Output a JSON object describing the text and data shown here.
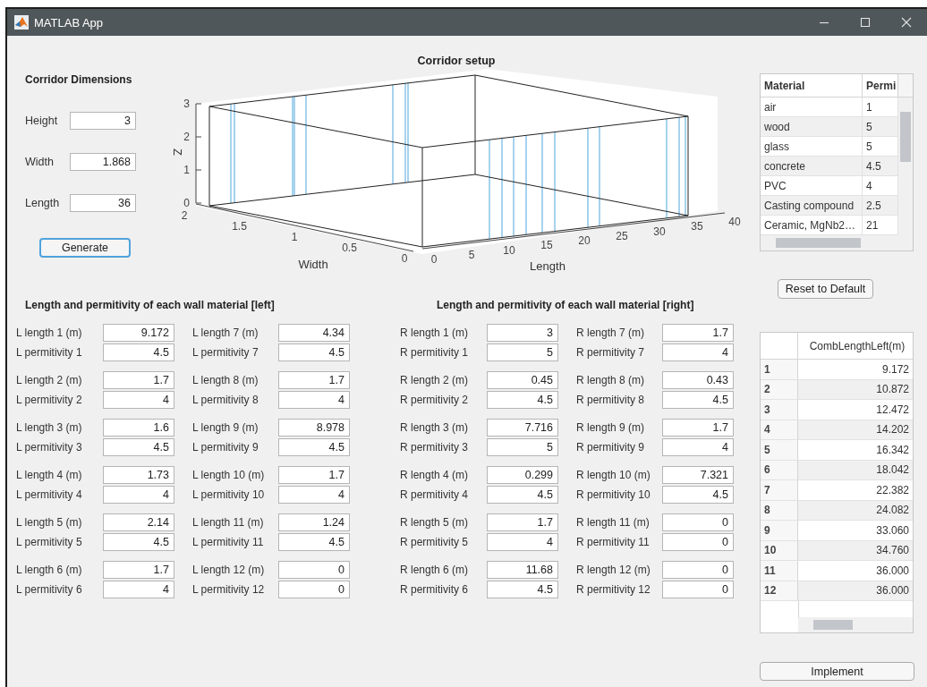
{
  "window": {
    "title": "MATLAB App"
  },
  "corridor_dimensions": {
    "title": "Corridor Dimensions",
    "fields": [
      {
        "label": "Height",
        "value": "3"
      },
      {
        "label": "Width",
        "value": "1.868"
      },
      {
        "label": "Length",
        "value": "36"
      }
    ],
    "generate_button": {
      "label": "Generate",
      "focused": true
    }
  },
  "plot": {
    "title": "Corridor setup",
    "z_label": "Z",
    "z_ticks": [
      "3",
      "2",
      "1",
      "0"
    ],
    "width_label": "Width",
    "width_ticks": [
      "2",
      "1.5",
      "1",
      "0.5",
      "0"
    ],
    "length_label": "Length",
    "length_ticks": [
      "0",
      "5",
      "10",
      "15",
      "20",
      "25",
      "30",
      "35",
      "40"
    ]
  },
  "walls": [
    {
      "title": "Length and permitivity of each wall material [left]",
      "entries": [
        {
          "length_label": "L length 1 (m)",
          "length": "9.172",
          "permittivity_label": "L permitivity 1",
          "permittivity": "4.5"
        },
        {
          "length_label": "L length 2 (m)",
          "length": "1.7",
          "permittivity_label": "L permitivity 2",
          "permittivity": "4"
        },
        {
          "length_label": "L length 3 (m)",
          "length": "1.6",
          "permittivity_label": "L permitivity 3",
          "permittivity": "4.5"
        },
        {
          "length_label": "L length 4 (m)",
          "length": "1.73",
          "permittivity_label": "L permitivity 4",
          "permittivity": "4"
        },
        {
          "length_label": "L length 5 (m)",
          "length": "2.14",
          "permittivity_label": "L permitivity 5",
          "permittivity": "4.5"
        },
        {
          "length_label": "L length 6 (m)",
          "length": "1.7",
          "permittivity_label": "L permitivity 6",
          "permittivity": "4"
        },
        {
          "length_label": "L length 7 (m)",
          "length": "4.34",
          "permittivity_label": "L permitivity 7",
          "permittivity": "4.5"
        },
        {
          "length_label": "L length 8 (m)",
          "length": "1.7",
          "permittivity_label": "L permitivity 8",
          "permittivity": "4"
        },
        {
          "length_label": "L length 9 (m)",
          "length": "8.978",
          "permittivity_label": "L permitivity 9",
          "permittivity": "4.5"
        },
        {
          "length_label": "L length 10 (m)",
          "length": "1.7",
          "permittivity_label": "L permitivity 10",
          "permittivity": "4"
        },
        {
          "length_label": "L length 11 (m)",
          "length": "1.24",
          "permittivity_label": "L permitivity 11",
          "permittivity": "4.5"
        },
        {
          "length_label": "L length 12 (m)",
          "length": "0",
          "permittivity_label": "L permitivity 12",
          "permittivity": "0"
        }
      ]
    },
    {
      "title": "Length and permitivity of each wall material [right]",
      "entries": [
        {
          "length_label": "R length 1 (m)",
          "length": "3",
          "permittivity_label": "R permitivity 1",
          "permittivity": "5"
        },
        {
          "length_label": "R length 2 (m)",
          "length": "0.45",
          "permittivity_label": "R permitivity 2",
          "permittivity": "4.5"
        },
        {
          "length_label": "R length 3 (m)",
          "length": "7.716",
          "permittivity_label": "R permitivity 3",
          "permittivity": "5"
        },
        {
          "length_label": "R length 4 (m)",
          "length": "0.299",
          "permittivity_label": "R permitivity 4",
          "permittivity": "4.5"
        },
        {
          "length_label": "R length 5 (m)",
          "length": "1.7",
          "permittivity_label": "R permitivity 5",
          "permittivity": "4"
        },
        {
          "length_label": "R length 6 (m)",
          "length": "11.68",
          "permittivity_label": "R permitivity 6",
          "permittivity": "4.5"
        },
        {
          "length_label": "R length 7 (m)",
          "length": "1.7",
          "permittivity_label": "R permitivity 7",
          "permittivity": "4"
        },
        {
          "length_label": "R length 8 (m)",
          "length": "0.43",
          "permittivity_label": "R permitivity 8",
          "permittivity": "4.5"
        },
        {
          "length_label": "R length 9 (m)",
          "length": "1.7",
          "permittivity_label": "R permitivity 9",
          "permittivity": "4"
        },
        {
          "length_label": "R length 10 (m)",
          "length": "7.321",
          "permittivity_label": "R permitivity 10",
          "permittivity": "4.5"
        },
        {
          "length_label": "R length 11 (m)",
          "length": "0",
          "permittivity_label": "R permitivity 11",
          "permittivity": "0"
        },
        {
          "length_label": "R length 12 (m)",
          "length": "0",
          "permittivity_label": "R permitivity 12",
          "permittivity": "0"
        }
      ]
    }
  ],
  "material_table": {
    "columns": [
      "Material",
      "Permi"
    ],
    "rows": [
      {
        "material": "air",
        "permittivity": "1"
      },
      {
        "material": "wood",
        "permittivity": "5"
      },
      {
        "material": "glass",
        "permittivity": "5"
      },
      {
        "material": "concrete",
        "permittivity": "4.5"
      },
      {
        "material": "PVC",
        "permittivity": "4"
      },
      {
        "material": "Casting compound",
        "permittivity": "2.5"
      },
      {
        "material": "Ceramic, MgNb2…",
        "permittivity": "21"
      }
    ]
  },
  "reset_button": {
    "label": "Reset to Default"
  },
  "comb_table": {
    "columns": [
      "CombLengthLeft(m)"
    ],
    "rows": [
      {
        "index": "1",
        "value": "9.172"
      },
      {
        "index": "2",
        "value": "10.872"
      },
      {
        "index": "3",
        "value": "12.472"
      },
      {
        "index": "4",
        "value": "14.202"
      },
      {
        "index": "5",
        "value": "16.342"
      },
      {
        "index": "6",
        "value": "18.042"
      },
      {
        "index": "7",
        "value": "22.382"
      },
      {
        "index": "8",
        "value": "24.082"
      },
      {
        "index": "9",
        "value": "33.060"
      },
      {
        "index": "10",
        "value": "34.760"
      },
      {
        "index": "11",
        "value": "36.000"
      },
      {
        "index": "12",
        "value": "36.000"
      }
    ]
  },
  "implement_button": {
    "label": "Implement"
  }
}
